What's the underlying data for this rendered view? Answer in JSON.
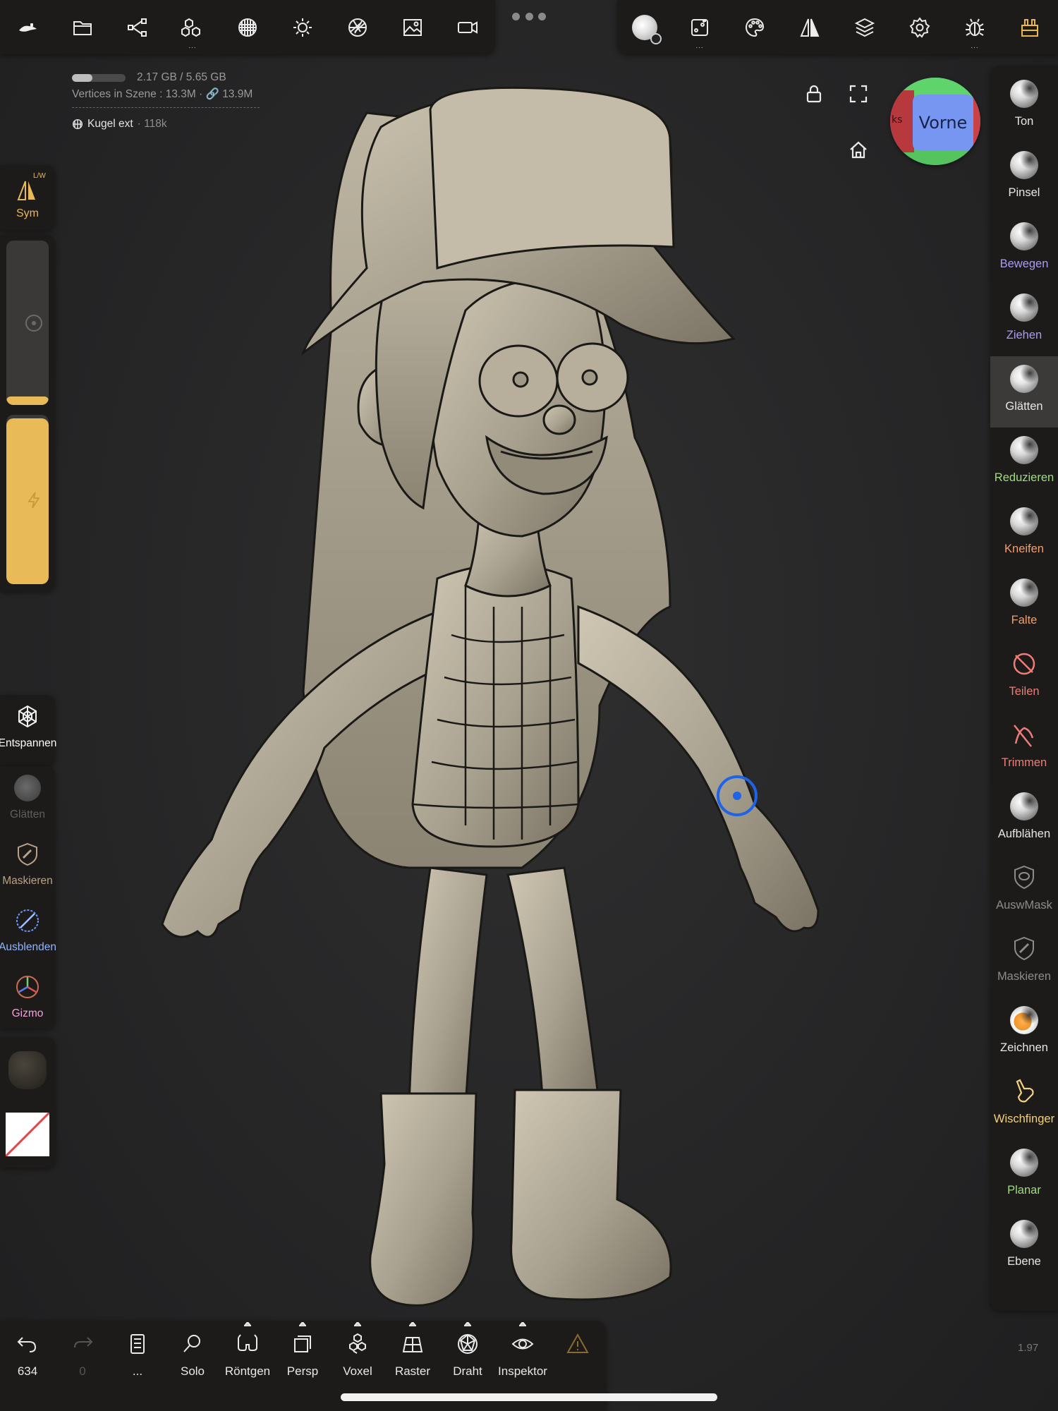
{
  "app": {
    "version": "1.97"
  },
  "top_toolbar_left": [
    {
      "icon": "nomad-logo-icon"
    },
    {
      "icon": "folder-icon"
    },
    {
      "icon": "scene-graph-icon"
    },
    {
      "icon": "mesh-cubes-icon",
      "more": "..."
    },
    {
      "icon": "topology-sphere-icon"
    },
    {
      "icon": "light-icon"
    },
    {
      "icon": "camera-aperture-icon"
    },
    {
      "icon": "background-image-icon"
    },
    {
      "icon": "video-camera-icon"
    }
  ],
  "top_toolbar_right": [
    {
      "icon": "brush-alpha-icon"
    },
    {
      "icon": "stroke-settings-icon",
      "more": "..."
    },
    {
      "icon": "palette-icon"
    },
    {
      "icon": "symmetry-icon"
    },
    {
      "icon": "layers-icon"
    },
    {
      "icon": "settings-gear-icon"
    },
    {
      "icon": "debug-bug-icon",
      "more": "..."
    },
    {
      "icon": "plugin-icon"
    }
  ],
  "info": {
    "memory": "2.17 GB / 5.65 GB",
    "memory_fraction": 0.38,
    "vertices_label": "Vertices in Szene :",
    "vertices_value": "13.3M",
    "vertices_linked": "13.9M",
    "object_name": "Kugel ext",
    "object_count": "118k"
  },
  "view_cube": {
    "front_label": "Vorne",
    "side_label": "ks"
  },
  "left_panel": {
    "symmetry": {
      "label": "Sym",
      "superscript": "L/W"
    },
    "radius_fraction": 0.05,
    "intensity_fraction": 0.98,
    "tools_top": [
      {
        "label": "Entspannen",
        "color": "#ffffff"
      }
    ],
    "tools": [
      {
        "label": "Glätten",
        "color": "#5f5f5f"
      },
      {
        "label": "Maskieren",
        "color": "#b8a38a"
      },
      {
        "label": "Ausblenden",
        "color": "#8fb4ff"
      },
      {
        "label": "Gizmo",
        "color": "#f0a3d8"
      }
    ]
  },
  "right_tools": [
    {
      "label": "Ton",
      "color": "#e6e6e6",
      "icon": "clay-sphere-icon"
    },
    {
      "label": "Pinsel",
      "color": "#e6e6e6",
      "icon": "brush-sphere-icon"
    },
    {
      "label": "Bewegen",
      "color": "#a99cf2",
      "icon": "move-sphere-icon"
    },
    {
      "label": "Ziehen",
      "color": "#a99cf2",
      "icon": "drag-sphere-icon"
    },
    {
      "label": "Glätten",
      "color": "#e6e6e6",
      "icon": "smooth-sphere-icon",
      "active": true
    },
    {
      "label": "Reduzieren",
      "color": "#9fdc7c",
      "icon": "flatten-sphere-icon"
    },
    {
      "label": "Kneifen",
      "color": "#f0a070",
      "icon": "pinch-sphere-icon"
    },
    {
      "label": "Falte",
      "color": "#f0a070",
      "icon": "crease-sphere-icon"
    },
    {
      "label": "Teilen",
      "color": "#ee7d78",
      "icon": "split-icon"
    },
    {
      "label": "Trimmen",
      "color": "#ee7d78",
      "icon": "trim-icon"
    },
    {
      "label": "Aufblähen",
      "color": "#e6e6e6",
      "icon": "inflate-sphere-icon"
    },
    {
      "label": "AuswMask",
      "color": "#8c8c8c",
      "icon": "select-mask-icon"
    },
    {
      "label": "Maskieren",
      "color": "#8c8c8c",
      "icon": "mask-icon"
    },
    {
      "label": "Zeichnen",
      "color": "#e6e6e6",
      "icon": "paint-sphere-icon"
    },
    {
      "label": "Wischfinger",
      "color": "#f2d17a",
      "icon": "smudge-finger-icon"
    },
    {
      "label": "Planar",
      "color": "#9fdc7c",
      "icon": "planar-sphere-icon"
    },
    {
      "label": "Ebene",
      "color": "#e6e6e6",
      "icon": "layer-sphere-icon"
    }
  ],
  "bottom_toolbar": [
    {
      "label": "634",
      "icon": "undo-icon"
    },
    {
      "label": "0",
      "icon": "redo-icon",
      "disabled": true
    },
    {
      "label": "...",
      "icon": "history-list-icon"
    },
    {
      "label": "Solo",
      "icon": "solo-search-icon"
    },
    {
      "label": "Röntgen",
      "icon": "xray-glasses-icon",
      "caret": true
    },
    {
      "label": "Persp",
      "icon": "perspective-icon",
      "caret": true
    },
    {
      "label": "Voxel",
      "icon": "voxel-icon",
      "caret": true
    },
    {
      "label": "Raster",
      "icon": "grid-icon",
      "caret": true
    },
    {
      "label": "Draht",
      "icon": "wireframe-icon",
      "caret": true
    },
    {
      "label": "Inspektor",
      "icon": "inspector-eye-icon",
      "caret": true
    },
    {
      "label": "",
      "icon": "warning-icon",
      "warning": true
    }
  ]
}
